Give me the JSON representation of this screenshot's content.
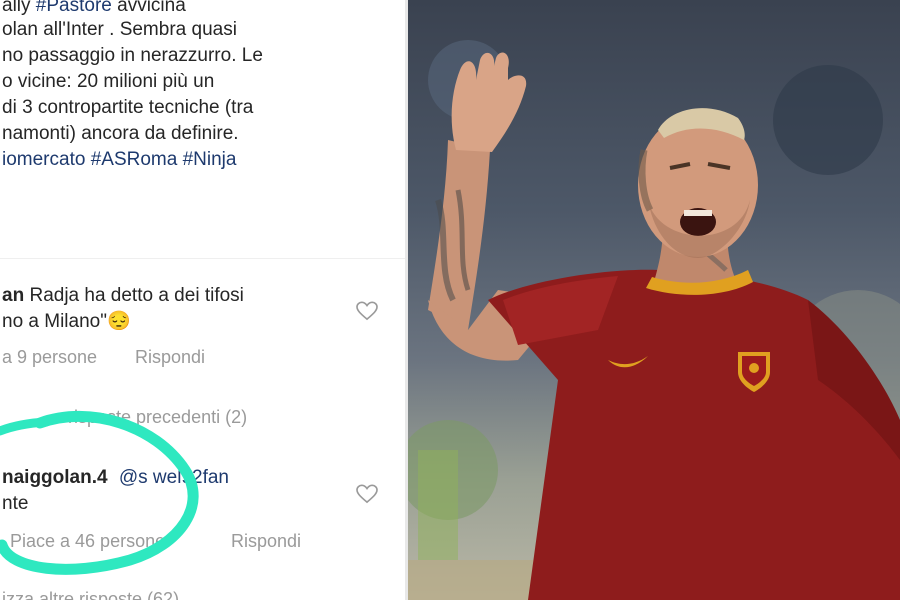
{
  "post": {
    "caption_lines": [
      {
        "pre": "ally ",
        "hashtag": "#Pastore",
        "post": " avvicina"
      },
      {
        "pre": "olan all'Inter . Sembra quasi",
        "hashtag": "",
        "post": ""
      },
      {
        "pre": "no passaggio in nerazzurro.  Le",
        "hashtag": "",
        "post": ""
      },
      {
        "pre": "o vicine: 20 milioni più un",
        "hashtag": "",
        "post": ""
      },
      {
        "pre": "di 3 contropartite tecniche (tra",
        "hashtag": "",
        "post": ""
      },
      {
        "pre": "namonti) ancora da definire.",
        "hashtag": "",
        "post": ""
      },
      {
        "pre": "",
        "hashtag": "iomercato #ASRoma #Ninja",
        "post": ""
      }
    ]
  },
  "comment1": {
    "username": "an",
    "text": "Radja ha detto a dei tifosi",
    "text2": "no a Milano\"😔",
    "likes": "a 9 persone",
    "reply": "Rispondi"
  },
  "view_previous": "risposte precedenti (2)",
  "comment2": {
    "username": "naiggolan.4",
    "mention": "@s  wel92fan",
    "text": "nte",
    "likes": "Piace a 46  persone",
    "reply": "Rispondi"
  },
  "view_more": "izza altre risposte (62)",
  "colors": {
    "annotation": "#2ee8c0",
    "jersey": "#8e1c1c",
    "collar": "#e0a020",
    "hashtag": "#1e3a6e"
  },
  "icons": [
    "heart-icon",
    "nike-swoosh-icon",
    "roma-crest-icon"
  ]
}
